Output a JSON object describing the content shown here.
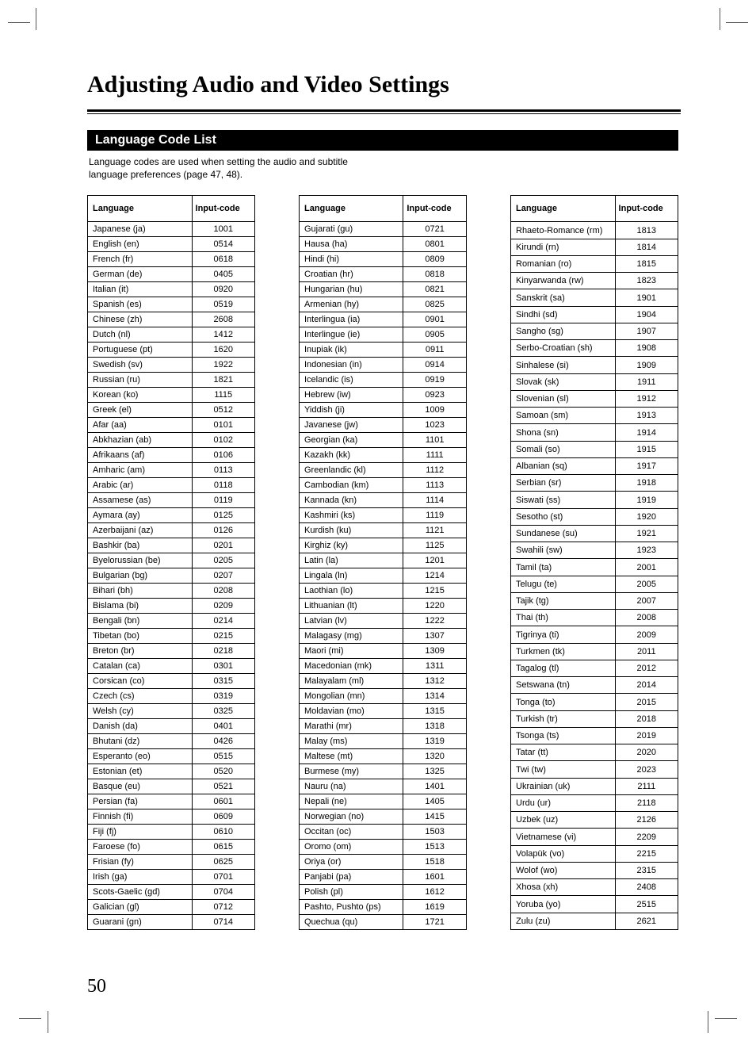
{
  "page_title": "Adjusting Audio and Video Settings",
  "section_title": "Language Code List",
  "intro_line1": "Language codes are used when setting the audio and subtitle",
  "intro_line2": "language preferences (page 47, 48).",
  "page_number": "50",
  "headers": {
    "lang": "Language",
    "code": "Input-code"
  },
  "col1": [
    {
      "l": "Japanese (ja)",
      "c": "1001"
    },
    {
      "l": "English (en)",
      "c": "0514"
    },
    {
      "l": "French (fr)",
      "c": "0618"
    },
    {
      "l": "German (de)",
      "c": "0405"
    },
    {
      "l": "Italian (it)",
      "c": "0920"
    },
    {
      "l": "Spanish (es)",
      "c": "0519"
    },
    {
      "l": "Chinese (zh)",
      "c": "2608"
    },
    {
      "l": "Dutch (nl)",
      "c": "1412"
    },
    {
      "l": "Portuguese (pt)",
      "c": "1620"
    },
    {
      "l": "Swedish (sv)",
      "c": "1922"
    },
    {
      "l": "Russian (ru)",
      "c": "1821"
    },
    {
      "l": "Korean (ko)",
      "c": "1115"
    },
    {
      "l": "Greek (el)",
      "c": "0512"
    },
    {
      "l": "Afar (aa)",
      "c": "0101"
    },
    {
      "l": "Abkhazian (ab)",
      "c": "0102"
    },
    {
      "l": "Afrikaans (af)",
      "c": "0106"
    },
    {
      "l": "Amharic (am)",
      "c": "0113"
    },
    {
      "l": "Arabic (ar)",
      "c": "0118"
    },
    {
      "l": "Assamese (as)",
      "c": "0119"
    },
    {
      "l": "Aymara (ay)",
      "c": "0125"
    },
    {
      "l": "Azerbaijani (az)",
      "c": "0126"
    },
    {
      "l": "Bashkir (ba)",
      "c": "0201"
    },
    {
      "l": "Byelorussian (be)",
      "c": "0205"
    },
    {
      "l": "Bulgarian (bg)",
      "c": "0207"
    },
    {
      "l": "Bihari (bh)",
      "c": "0208"
    },
    {
      "l": "Bislama (bi)",
      "c": "0209"
    },
    {
      "l": "Bengali (bn)",
      "c": "0214"
    },
    {
      "l": "Tibetan (bo)",
      "c": "0215"
    },
    {
      "l": "Breton (br)",
      "c": "0218"
    },
    {
      "l": "Catalan (ca)",
      "c": "0301"
    },
    {
      "l": "Corsican (co)",
      "c": "0315"
    },
    {
      "l": "Czech (cs)",
      "c": "0319"
    },
    {
      "l": "Welsh (cy)",
      "c": "0325"
    },
    {
      "l": "Danish (da)",
      "c": "0401"
    },
    {
      "l": "Bhutani (dz)",
      "c": "0426"
    },
    {
      "l": "Esperanto (eo)",
      "c": "0515"
    },
    {
      "l": "Estonian (et)",
      "c": "0520"
    },
    {
      "l": "Basque (eu)",
      "c": "0521"
    },
    {
      "l": "Persian (fa)",
      "c": "0601"
    },
    {
      "l": "Finnish (fi)",
      "c": "0609"
    },
    {
      "l": "Fiji (fj)",
      "c": "0610"
    },
    {
      "l": "Faroese (fo)",
      "c": "0615"
    },
    {
      "l": "Frisian (fy)",
      "c": "0625"
    },
    {
      "l": "Irish (ga)",
      "c": "0701"
    },
    {
      "l": "Scots-Gaelic (gd)",
      "c": "0704"
    },
    {
      "l": "Galician (gl)",
      "c": "0712"
    },
    {
      "l": "Guarani (gn)",
      "c": "0714"
    }
  ],
  "col2": [
    {
      "l": "Gujarati (gu)",
      "c": "0721"
    },
    {
      "l": "Hausa (ha)",
      "c": "0801"
    },
    {
      "l": "Hindi (hi)",
      "c": "0809"
    },
    {
      "l": "Croatian (hr)",
      "c": "0818"
    },
    {
      "l": "Hungarian (hu)",
      "c": "0821"
    },
    {
      "l": "Armenian (hy)",
      "c": "0825"
    },
    {
      "l": "Interlingua (ia)",
      "c": "0901"
    },
    {
      "l": "Interlingue (ie)",
      "c": "0905"
    },
    {
      "l": "Inupiak (ik)",
      "c": "0911"
    },
    {
      "l": "Indonesian (in)",
      "c": "0914"
    },
    {
      "l": "Icelandic (is)",
      "c": "0919"
    },
    {
      "l": "Hebrew (iw)",
      "c": "0923"
    },
    {
      "l": "Yiddish (ji)",
      "c": "1009"
    },
    {
      "l": "Javanese (jw)",
      "c": "1023"
    },
    {
      "l": "Georgian (ka)",
      "c": "1101"
    },
    {
      "l": "Kazakh (kk)",
      "c": "1111"
    },
    {
      "l": "Greenlandic (kl)",
      "c": "1112"
    },
    {
      "l": "Cambodian (km)",
      "c": "1113"
    },
    {
      "l": "Kannada (kn)",
      "c": "1114"
    },
    {
      "l": "Kashmiri (ks)",
      "c": "1119"
    },
    {
      "l": "Kurdish (ku)",
      "c": "1121"
    },
    {
      "l": "Kirghiz (ky)",
      "c": "1125"
    },
    {
      "l": "Latin (la)",
      "c": "1201"
    },
    {
      "l": "Lingala (ln)",
      "c": "1214"
    },
    {
      "l": "Laothian (lo)",
      "c": "1215"
    },
    {
      "l": "Lithuanian (lt)",
      "c": "1220"
    },
    {
      "l": "Latvian (lv)",
      "c": "1222"
    },
    {
      "l": "Malagasy (mg)",
      "c": "1307"
    },
    {
      "l": "Maori (mi)",
      "c": "1309"
    },
    {
      "l": "Macedonian (mk)",
      "c": "1311"
    },
    {
      "l": "Malayalam (ml)",
      "c": "1312"
    },
    {
      "l": "Mongolian (mn)",
      "c": "1314"
    },
    {
      "l": "Moldavian (mo)",
      "c": "1315"
    },
    {
      "l": "Marathi (mr)",
      "c": "1318"
    },
    {
      "l": "Malay (ms)",
      "c": "1319"
    },
    {
      "l": "Maltese (mt)",
      "c": "1320"
    },
    {
      "l": "Burmese (my)",
      "c": "1325"
    },
    {
      "l": "Nauru (na)",
      "c": "1401"
    },
    {
      "l": "Nepali (ne)",
      "c": "1405"
    },
    {
      "l": "Norwegian (no)",
      "c": "1415"
    },
    {
      "l": "Occitan (oc)",
      "c": "1503"
    },
    {
      "l": "Oromo (om)",
      "c": "1513"
    },
    {
      "l": "Oriya (or)",
      "c": "1518"
    },
    {
      "l": "Panjabi (pa)",
      "c": "1601"
    },
    {
      "l": "Polish (pl)",
      "c": "1612"
    },
    {
      "l": "Pashto, Pushto (ps)",
      "c": "1619"
    },
    {
      "l": "Quechua (qu)",
      "c": "1721"
    }
  ],
  "col3": [
    {
      "l": "Rhaeto-Romance (rm)",
      "c": "1813"
    },
    {
      "l": "Kirundi (rn)",
      "c": "1814"
    },
    {
      "l": "Romanian (ro)",
      "c": "1815"
    },
    {
      "l": "Kinyarwanda (rw)",
      "c": "1823"
    },
    {
      "l": "Sanskrit (sa)",
      "c": "1901"
    },
    {
      "l": "Sindhi (sd)",
      "c": "1904"
    },
    {
      "l": "Sangho (sg)",
      "c": "1907"
    },
    {
      "l": "Serbo-Croatian (sh)",
      "c": "1908"
    },
    {
      "l": "Sinhalese (si)",
      "c": "1909"
    },
    {
      "l": "Slovak (sk)",
      "c": "1911"
    },
    {
      "l": "Slovenian (sl)",
      "c": "1912"
    },
    {
      "l": "Samoan (sm)",
      "c": "1913"
    },
    {
      "l": "Shona (sn)",
      "c": "1914"
    },
    {
      "l": "Somali (so)",
      "c": "1915"
    },
    {
      "l": "Albanian (sq)",
      "c": "1917"
    },
    {
      "l": "Serbian (sr)",
      "c": "1918"
    },
    {
      "l": "Siswati (ss)",
      "c": "1919"
    },
    {
      "l": "Sesotho (st)",
      "c": "1920"
    },
    {
      "l": "Sundanese (su)",
      "c": "1921"
    },
    {
      "l": "Swahili (sw)",
      "c": "1923"
    },
    {
      "l": "Tamil (ta)",
      "c": "2001"
    },
    {
      "l": "Telugu (te)",
      "c": "2005"
    },
    {
      "l": "Tajik (tg)",
      "c": "2007"
    },
    {
      "l": "Thai (th)",
      "c": "2008"
    },
    {
      "l": "Tigrinya (ti)",
      "c": "2009"
    },
    {
      "l": "Turkmen (tk)",
      "c": "2011"
    },
    {
      "l": "Tagalog (tl)",
      "c": "2012"
    },
    {
      "l": "Setswana (tn)",
      "c": "2014"
    },
    {
      "l": "Tonga (to)",
      "c": "2015"
    },
    {
      "l": "Turkish (tr)",
      "c": "2018"
    },
    {
      "l": "Tsonga (ts)",
      "c": "2019"
    },
    {
      "l": "Tatar (tt)",
      "c": "2020"
    },
    {
      "l": "Twi (tw)",
      "c": "2023"
    },
    {
      "l": "Ukrainian (uk)",
      "c": "2111"
    },
    {
      "l": "Urdu (ur)",
      "c": "2118"
    },
    {
      "l": "Uzbek (uz)",
      "c": "2126"
    },
    {
      "l": "Vietnamese (vi)",
      "c": "2209"
    },
    {
      "l": "Volapük (vo)",
      "c": "2215"
    },
    {
      "l": "Wolof (wo)",
      "c": "2315"
    },
    {
      "l": "Xhosa (xh)",
      "c": "2408"
    },
    {
      "l": "Yoruba (yo)",
      "c": "2515"
    },
    {
      "l": "Zulu (zu)",
      "c": "2621"
    }
  ]
}
